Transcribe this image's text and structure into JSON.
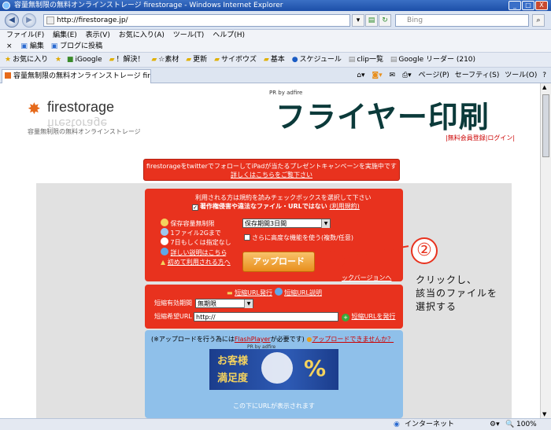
{
  "window": {
    "title": "容量無制限の無料オンラインストレージ firestorage - Windows Internet Explorer",
    "minimize": "_",
    "maximize": "□",
    "close": "X"
  },
  "address": {
    "url": "http://firestorage.jp/",
    "search_placeholder": "Bing"
  },
  "menubar": {
    "items": [
      "ファイル(F)",
      "編集(E)",
      "表示(V)",
      "お気に入り(A)",
      "ツール(T)",
      "ヘルプ(H)"
    ]
  },
  "toolbar2": {
    "close": "×",
    "edit": "編集",
    "blog": "ブログに投稿"
  },
  "favorites": {
    "items": [
      "お気に入り",
      "iGoogle",
      "！解決！",
      "☆素材",
      "更新",
      "サイボウズ",
      "基本",
      "スケジュール",
      "clip一覧",
      "Google リーダー (210)"
    ]
  },
  "tab": {
    "title": "容量無制限の無料オンラインストレージ firestorage"
  },
  "tab_tools": {
    "page": "ページ(P)",
    "safety": "セーフティ(S)",
    "tools": "ツール(O)",
    "help": "?"
  },
  "page": {
    "logo_name": "firestorage",
    "logo_tagline": "容量無制限の無料オンラインストレージ",
    "ad_pr": "PR by adfire",
    "ad_text": "フライヤー印刷",
    "register_link": "無料会員登録",
    "login_link": "ログイン",
    "promo_line1": "firestorageをtwitterでフォローしてiPadが当たるプレゼントキャンペーンを実施中です",
    "promo_line2": "詳しくはこちらをご覧下さい",
    "terms_instruction": "利用される方は規約を読みチェックボックスを選択して下さい",
    "terms_check": "著作権侵害や違法なファイル・URLではない",
    "terms_link": "(利用規約)",
    "period_label": "保存容量無制限",
    "period_select": "保存期間3日間",
    "size_label": "1ファイル2Gまで",
    "default_label": "7日もしくは指定なし",
    "advanced_check": "さらに高度な機能を使う(複数/任意)",
    "detail_label": "詳しい説明はこちら",
    "first_time_label": "初めて利用される方へ",
    "upload_button": "アップロード",
    "flash_version_link": "ックバージョンへ",
    "short_url_issue": "短縮URL発行",
    "short_url_help": "短縮URL説明",
    "short_url_period_label": "短縮有効期間",
    "short_url_period_value": "無期限",
    "short_url_wish_label": "短縮希望URL",
    "short_url_value": "http://",
    "short_url_button": "短縮URLを発行",
    "flash_notice_pre": "(※アップロードを行う為には",
    "flash_notice_link": "FlashPlayer",
    "flash_notice_post": "が必要です)",
    "cannot_upload": "アップロードできませんか？",
    "banner_pr": "PR by adfire",
    "banner_text_1": "お客様",
    "banner_text_2": "満足度",
    "banner_percent": "%",
    "url_displayed_here": "この下にURLが表示されます"
  },
  "annotation": {
    "step_number": "②",
    "caption_line1": "クリックし、",
    "caption_line2": "該当のファイルを",
    "caption_line3": "選択する"
  },
  "statusbar": {
    "zone": "インターネット",
    "zoom": "100%"
  },
  "colors": {
    "accent_red": "#e8321e",
    "upload_orange": "#e88f1d",
    "ie_title_blue": "#1d4fa8"
  }
}
